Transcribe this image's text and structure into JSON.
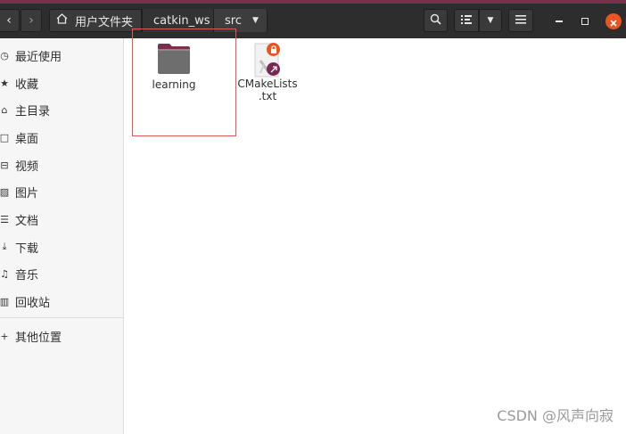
{
  "window": {
    "accent_color": "#7a2f4b",
    "headerbar_color": "#2d2d2d"
  },
  "nav": {
    "back_icon": "chevron-left-icon",
    "forward_icon": "chevron-right-icon"
  },
  "breadcrumb": {
    "home_icon": "home-icon",
    "items": [
      {
        "label": "用户文件夹"
      },
      {
        "label": "catkin_ws"
      },
      {
        "label": "src"
      }
    ]
  },
  "toolbar": {
    "search_icon": "search-icon",
    "view_icon": "list-view-icon",
    "menu_icon": "hamburger-menu-icon"
  },
  "sidebar": {
    "items": [
      {
        "icon": "clock-icon",
        "label": "最近使用"
      },
      {
        "icon": "star-icon",
        "label": "收藏"
      },
      {
        "icon": "home-icon",
        "label": "主目录"
      },
      {
        "icon": "desktop-icon",
        "label": "桌面"
      },
      {
        "icon": "video-icon",
        "label": "视频"
      },
      {
        "icon": "picture-icon",
        "label": "图片"
      },
      {
        "icon": "document-icon",
        "label": "文档"
      },
      {
        "icon": "download-icon",
        "label": "下载"
      },
      {
        "icon": "music-icon",
        "label": "音乐"
      },
      {
        "icon": "trash-icon",
        "label": "回收站"
      }
    ],
    "other": {
      "icon": "plus-icon",
      "label": "其他位置"
    }
  },
  "files": [
    {
      "name": "learning",
      "type": "folder"
    },
    {
      "name_line1": "CMakeLists",
      "name_line2": ".txt",
      "type": "text-file-link"
    }
  ],
  "watermark": "CSDN @风声向寂"
}
